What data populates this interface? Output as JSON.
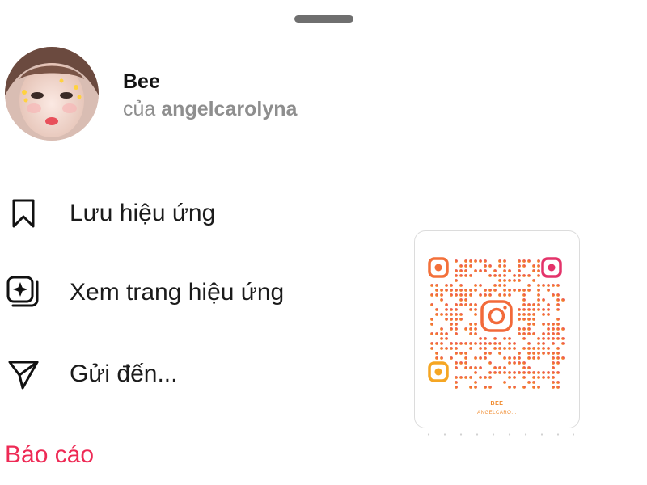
{
  "sheet": {
    "grabber": "drag-handle"
  },
  "effect": {
    "name": "Bee",
    "byline_prefix": "của",
    "author": "angelcarolyna"
  },
  "menu": {
    "items": [
      {
        "label": "Lưu hiệu ứng",
        "icon": "bookmark-icon"
      },
      {
        "label": "Xem trang hiệu ứng",
        "icon": "effects-page-icon"
      },
      {
        "label": "Gửi đến...",
        "icon": "send-icon"
      }
    ],
    "report_label": "Báo cáo"
  },
  "qr_card": {
    "title": "BEE",
    "subtitle": "ANGELCARO...",
    "icon": "instagram-logo-icon"
  },
  "colors": {
    "report": "#ee2a55",
    "muted_text": "#8e8e8e",
    "qr_gradient_start": "#f5a623",
    "qr_gradient_end": "#e1306c"
  }
}
